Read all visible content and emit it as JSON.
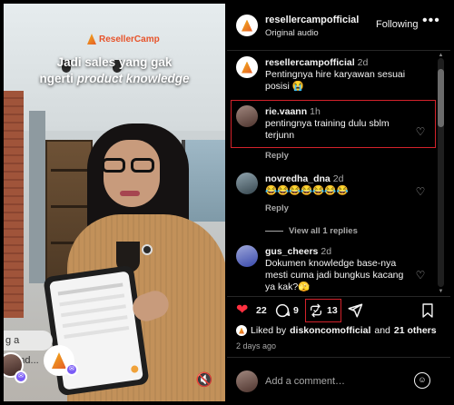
{
  "video": {
    "brand": "ResellerCamp",
    "headline_line1": "Jadi sales yang gak",
    "headline_line2_plain": "ngerti",
    "headline_line2_italic": "product knowledge",
    "share_placeholder": "g a friend...",
    "mute_icon": "speaker-muted-icon"
  },
  "header": {
    "username": "resellercampofficial",
    "audio": "Original audio",
    "follow_label": "Following",
    "more_icon": "more-horizontal-icon"
  },
  "caption": {
    "username": "resellercampofficial",
    "time": "2d",
    "text": "Pentingnya hire karyawan sesuai posisi 😭"
  },
  "comments": [
    {
      "username": "rie.vaann",
      "time": "1h",
      "text": "pentingnya training dulu sblm terjunn",
      "reply_label": "Reply"
    },
    {
      "username": "novredha_dna",
      "time": "2d",
      "text": "😂😂😂😂😂😂😂",
      "reply_label": "Reply",
      "view_replies": "View all 1 replies"
    },
    {
      "username": "gus_cheers",
      "time": "2d",
      "text": "Dokumen knowledge base-nya mesti cuma jadi bungkus kacang ya kak?🫣"
    }
  ],
  "actions": {
    "like_icon": "heart-filled-icon",
    "like_count": "22",
    "comment_icon": "comment-icon",
    "comment_count": "9",
    "repost_icon": "repost-icon",
    "repost_count": "13",
    "share_icon": "send-icon",
    "save_icon": "bookmark-icon",
    "like_color": "#ff3040"
  },
  "liked_by": {
    "prefix": "Liked by",
    "user": "diskoncomofficial",
    "middle": "and",
    "others": "21 others"
  },
  "timestamp": "2 days ago",
  "composer": {
    "placeholder": "Add a comment…",
    "emoji_icon": "emoji-icon"
  },
  "colors": {
    "highlight": "#d3222b",
    "brand_orange": "#e45b27",
    "background": "#000000"
  }
}
